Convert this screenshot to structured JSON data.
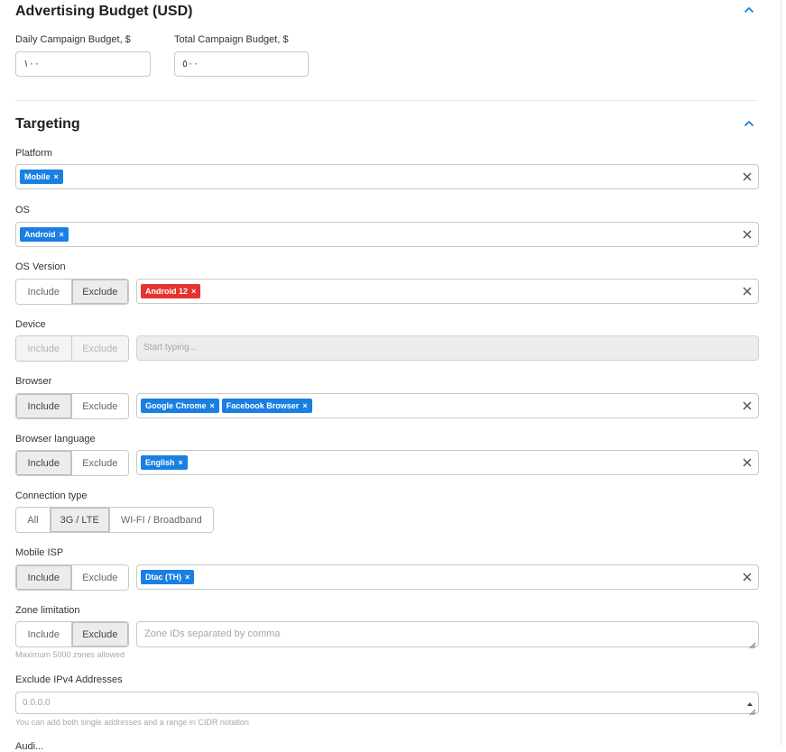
{
  "budget": {
    "title": "Advertising Budget (USD)",
    "daily_label": "Daily Campaign Budget, $",
    "daily_value": "١٠٠",
    "total_label": "Total Campaign Budget, $",
    "total_value": "٥٠٠"
  },
  "targeting": {
    "title": "Targeting",
    "platform": {
      "label": "Platform",
      "tags": [
        "Mobile"
      ]
    },
    "os": {
      "label": "OS",
      "tags": [
        "Android"
      ]
    },
    "os_version": {
      "label": "OS Version",
      "include": "Include",
      "exclude": "Exclude",
      "tags": [
        "Android 12"
      ]
    },
    "device": {
      "label": "Device",
      "include": "Include",
      "exclude": "Exclude",
      "placeholder": "Start typing..."
    },
    "browser": {
      "label": "Browser",
      "include": "Include",
      "exclude": "Exclude",
      "tags": [
        "Google Chrome",
        "Facebook Browser"
      ]
    },
    "browser_language": {
      "label": "Browser language",
      "include": "Include",
      "exclude": "Exclude",
      "tags": [
        "English"
      ]
    },
    "connection_type": {
      "label": "Connection type",
      "options": [
        "All",
        "3G / LTE",
        "WI-FI / Broadband"
      ],
      "selected": "3G / LTE"
    },
    "mobile_isp": {
      "label": "Mobile ISP",
      "include": "Include",
      "exclude": "Exclude",
      "tags": [
        "Dtac (TH)"
      ]
    },
    "zone_limitation": {
      "label": "Zone limitation",
      "include": "Include",
      "exclude": "Exclude",
      "placeholder": "Zone IDs separated by comma",
      "hint": "Maximum 5000 zones allowed"
    },
    "exclude_ipv4": {
      "label": "Exclude IPv4 Addresses",
      "placeholder": "0.0.0.0",
      "hint": "You can add both single addresses and a range in CIDR notation"
    },
    "next_label": "Audi..."
  },
  "tag_remove_glyph": "×",
  "colors": {
    "accent": "#1a7fe3",
    "exclude_tag": "#e5332f",
    "chevron": "#1a7fd6"
  }
}
